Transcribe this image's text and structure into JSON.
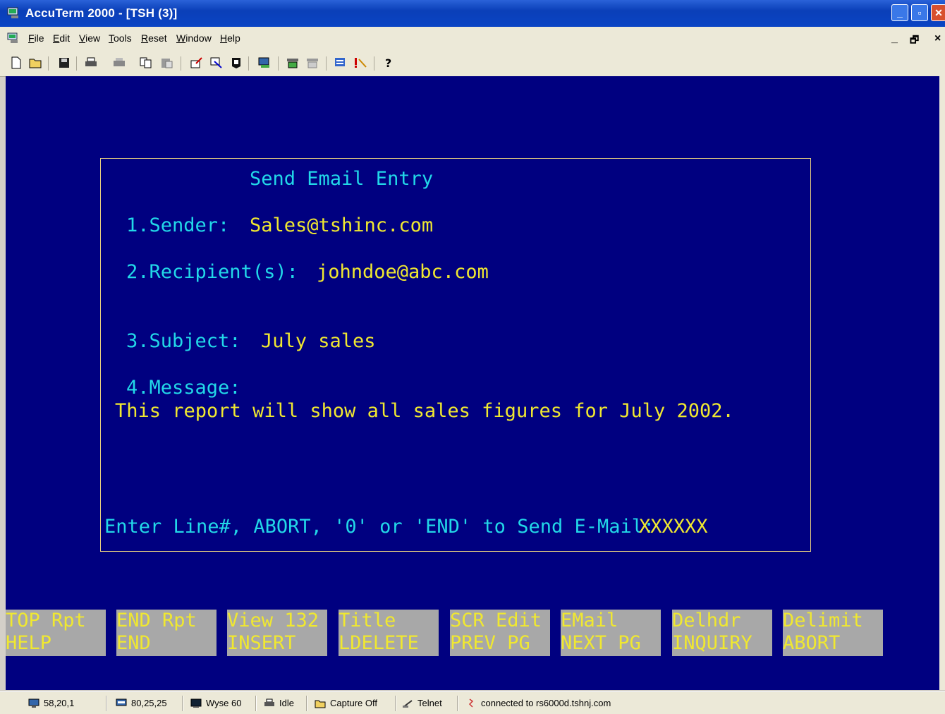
{
  "window": {
    "title": "AccuTerm 2000 - [TSH (3)]",
    "minimize": "_",
    "maximize": "▫",
    "close": "✕"
  },
  "menu": {
    "items": [
      "File",
      "Edit",
      "View",
      "Tools",
      "Reset",
      "Window",
      "Help"
    ],
    "mdi_min": "_",
    "mdi_restore": "🗗",
    "mdi_close": "×"
  },
  "toolbar": {
    "icons": [
      "new-icon",
      "open-icon",
      "save-icon",
      "print-icon",
      "print-setup-icon",
      "copy-icon",
      "paste-icon",
      "upload-icon",
      "download-icon",
      "capture-icon",
      "properties-icon",
      "keyboard-icon",
      "macro-icon",
      "message-icon",
      "alert-icon",
      "help-icon"
    ]
  },
  "screen": {
    "heading": "Send Email Entry",
    "sender_label": "1.Sender:",
    "sender_value": "Sales@tshinc.com",
    "recipient_label": "2.Recipient(s):",
    "recipient_value": "johndoe@abc.com",
    "subject_label": "3.Subject:",
    "subject_value": "July sales",
    "message_label": "4.Message:",
    "message_value": "This report will show all sales figures for July 2002.",
    "prompt": "Enter Line#, ABORT, '0' or 'END' to Send E-Mail:",
    "prompt_input": "XXXXXX"
  },
  "function_keys": [
    {
      "line1": "TOP Rpt",
      "line2": "HELP"
    },
    {
      "line1": "END Rpt",
      "line2": "END"
    },
    {
      "line1": "View 132",
      "line2": "INSERT"
    },
    {
      "line1": "Title",
      "line2": "LDELETE"
    },
    {
      "line1": "SCR Edit",
      "line2": "PREV PG"
    },
    {
      "line1": "EMail",
      "line2": "NEXT PG"
    },
    {
      "line1": "Delhdr",
      "line2": "INQUIRY"
    },
    {
      "line1": "Delimit",
      "line2": "ABORT"
    }
  ],
  "status": {
    "cursor": "58,20,1",
    "size": "80,25,25",
    "emulation": "Wyse 60",
    "print": "Idle",
    "capture": "Capture Off",
    "protocol": "Telnet",
    "connection": "connected to rs6000d.tshnj.com"
  },
  "colors": {
    "terminal_bg": "#000080",
    "cyan": "#22d8e8",
    "yellow": "#f0e830",
    "fkey_bg": "#a8a8a8"
  }
}
